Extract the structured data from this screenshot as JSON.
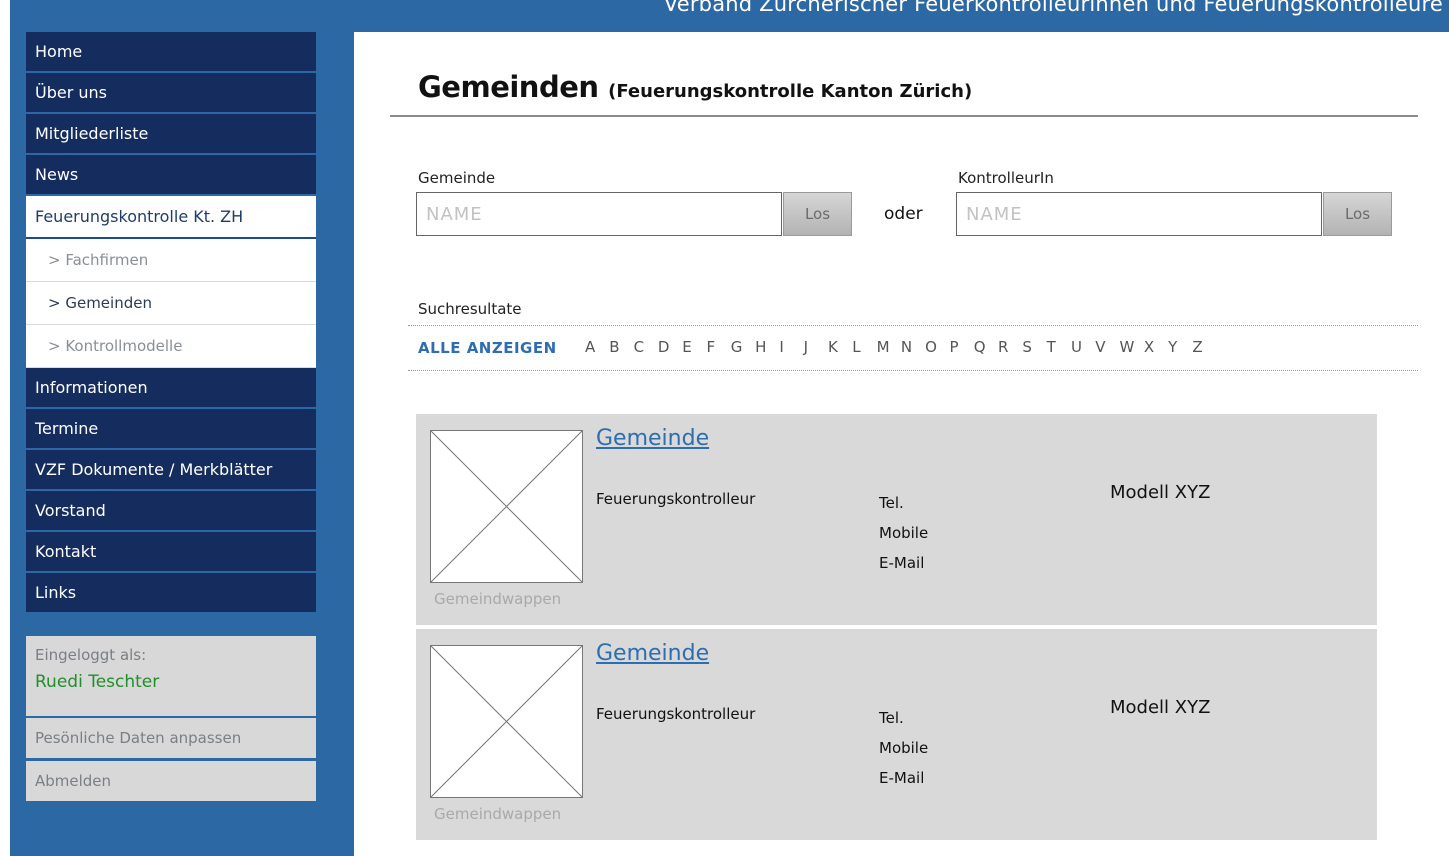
{
  "header": {
    "site_title": "Verband Zürcherischer Feuerkontrolleurinnen und Feuerungskontrolleure"
  },
  "nav": {
    "items": [
      {
        "label": "Home"
      },
      {
        "label": "Über uns"
      },
      {
        "label": "Mitgliederliste"
      },
      {
        "label": "News"
      },
      {
        "label": "Feuerungskontrolle Kt. ZH"
      }
    ],
    "subitems": [
      {
        "label": "> Fachfirmen"
      },
      {
        "label": "> Gemeinden"
      },
      {
        "label": "> Kontrollmodelle"
      }
    ],
    "items_after": [
      {
        "label": "Informationen"
      },
      {
        "label": "Termine"
      },
      {
        "label": "VZF Dokumente / Merkblätter"
      },
      {
        "label": "Vorstand"
      },
      {
        "label": "Kontakt"
      },
      {
        "label": "Links"
      }
    ]
  },
  "account": {
    "logged_in_label": "Eingeloggt als:",
    "user_name": "Ruedi Teschter",
    "edit_link": "Pesönliche Daten anpassen",
    "logout_link": "Abmelden"
  },
  "main": {
    "title": "Gemeinden",
    "subtitle": "(Feuerungskontrolle Kanton Zürich)",
    "search": {
      "municipality_label": "Gemeinde",
      "municipality_placeholder": "NAME",
      "inspector_label": "KontrolleurIn",
      "inspector_placeholder": "NAME",
      "go_label": "Los",
      "or_label": "oder"
    },
    "results_label": "Suchresultate",
    "show_all": "ALLE ANZEIGEN",
    "letters": [
      "A",
      "B",
      "C",
      "D",
      "E",
      "F",
      "G",
      "H",
      "I",
      "J",
      "K",
      "L",
      "M",
      "N",
      "O",
      "P",
      "Q",
      "R",
      "S",
      "T",
      "U",
      "V",
      "W",
      "X",
      "Y",
      "Z"
    ],
    "results": [
      {
        "name": "Gemeinde",
        "crest_caption": "Gemeindwappen",
        "inspector": "Feuerungskontrolleur",
        "tel": "Tel.",
        "mobile": "Mobile",
        "email": "E-Mail",
        "model": "Modell XYZ"
      },
      {
        "name": "Gemeinde",
        "crest_caption": "Gemeindwappen",
        "inspector": "Feuerungskontrolleur",
        "tel": "Tel.",
        "mobile": "Mobile",
        "email": "E-Mail",
        "model": "Modell XYZ"
      }
    ]
  },
  "colors": {
    "nav_dark": "#152d5e",
    "page_blue": "#2c69a4",
    "link_blue": "#2d6db0",
    "user_green": "#1f8f2a",
    "card_grey": "#d9d9d9"
  }
}
